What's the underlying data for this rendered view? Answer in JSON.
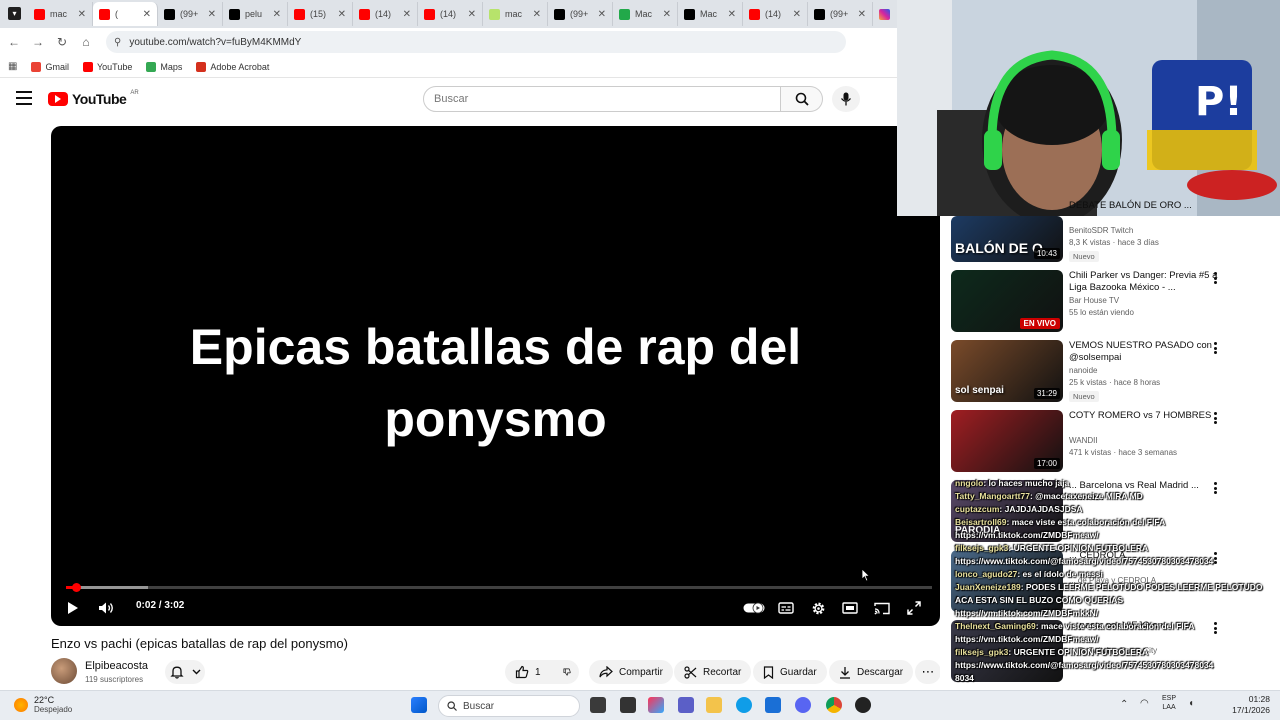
{
  "browser": {
    "tabs": [
      {
        "label": "mac",
        "color": "#ff0000"
      },
      {
        "label": "(",
        "color": "#ff0000"
      },
      {
        "label": "(99+",
        "color": "#000000"
      },
      {
        "label": "pelu",
        "color": "#000000"
      },
      {
        "label": "(15)",
        "color": "#ff0000"
      },
      {
        "label": "(14)",
        "color": "#ff0000"
      },
      {
        "label": "(14)",
        "color": "#ff0000"
      },
      {
        "label": "mac",
        "color": "#b7e36b"
      },
      {
        "label": "(99+",
        "color": "#000000"
      },
      {
        "label": "Mac",
        "color": "#22a94a"
      },
      {
        "label": "Mac",
        "color": "#000000"
      },
      {
        "label": "(14)",
        "color": "#ff0000"
      },
      {
        "label": "(99+",
        "color": "#000000"
      }
    ],
    "close_glyph": "✕",
    "url": "youtube.com/watch?v=fuByM4KMMdY",
    "bookmarks": [
      {
        "label": "Gmail",
        "color": "#ea4335"
      },
      {
        "label": "YouTube",
        "color": "#ff0000"
      },
      {
        "label": "Maps",
        "color": "#34a853"
      },
      {
        "label": "Adobe Acrobat",
        "color": "#d4301d"
      }
    ]
  },
  "youtube": {
    "logo_text": "YouTube",
    "logo_region": "AR",
    "search_placeholder": "Buscar"
  },
  "player": {
    "overlay_title_line1": "Epicas batallas de rap del",
    "overlay_title_line2": "ponysmo",
    "time": "0:02 / 3:02",
    "played_fraction": 0.011,
    "buffered_fraction": 0.095
  },
  "video": {
    "title": "Enzo vs pachi (epicas batallas de rap del ponysmo)",
    "channel_name": "Elpibeacosta",
    "subscribers": "119 suscriptores",
    "likes": "1",
    "share_label": "Compartir",
    "clip_label": "Recortar",
    "save_label": "Guardar",
    "download_label": "Descargar",
    "more_glyph": "⋯"
  },
  "recommendations": [
    {
      "title": "DEBATE BALÓN DE ORO ...",
      "channel": "BenitoSDR Twitch",
      "meta": "8,3 K vistas · hace 3 días",
      "badge": "Nuevo",
      "thumb_text": "BALÓN DE O",
      "duration": "10:43",
      "thumb_color": "#1d3b63"
    },
    {
      "title": "Chili Parker vs Danger: Previa #5 a Liga Bazooka México - ...",
      "channel": "Bar House TV",
      "meta": "55 lo están viendo",
      "badge": "",
      "thumb_text": "",
      "duration": "EN VIVO",
      "thumb_color": "#0d2a1c"
    },
    {
      "title": "VEMOS NUESTRO PASADO con @solsempai",
      "channel": "nanoide",
      "meta": "25 k vistas · hace 8 horas",
      "badge": "Nuevo",
      "thumb_text": "sol senpai",
      "duration": "31:29",
      "thumb_color": "#7a4b2a"
    },
    {
      "title": "COTY ROMERO vs 7 HOMBRES",
      "channel": "WANDII",
      "meta": "471 k vistas · hace 3 semanas",
      "badge": "",
      "thumb_text": "",
      "duration": "17:00",
      "thumb_color": "#a01e22"
    },
    {
      "title": "... Barcelona vs Real Madrid ... Mareo...",
      "channel": "",
      "meta": "",
      "badge": "",
      "thumb_text": "PARODIA",
      "duration": "",
      "thumb_color": "#5a4a6a"
    },
    {
      "title": "... CEDROLA",
      "channel": "... de Playa y CEDROLA",
      "meta": "",
      "badge": "",
      "thumb_text": "",
      "duration": "",
      "thumb_color": "#4a6a8a"
    },
    {
      "title": "... pasar por VIEJO en ...",
      "channel": "... Tv Twitch y Rama City",
      "meta": "",
      "badge": "",
      "thumb_text": "",
      "duration": "",
      "thumb_color": "#3a3a4a"
    }
  ],
  "chat": [
    {
      "user": "nngolo",
      "text": ": lo haces mucho jaja"
    },
    {
      "user": "Tatty_Mangoartt77",
      "text": ": @macetaxeneize MIRA MD"
    },
    {
      "user": "cuptazcum",
      "text": ": JAJDJAJDASJDSA"
    },
    {
      "user": "Beisartroll69",
      "text": ": mace viste esta colaboración del FIFA"
    },
    {
      "user": "",
      "text": "https://vm.tiktok.com/ZMDBFmeaw/"
    },
    {
      "user": "filksejs_gpk3",
      "text": ": URGENTE OPINION FUTBOLERA"
    },
    {
      "user": "",
      "text": "https://www.tiktok.com/@famosarg/video/7574530780303478034"
    },
    {
      "user": "lonco_agudo27",
      "text": ": es el ídolo de messi"
    },
    {
      "user": "JuanXeneize189",
      "text": ": PODES LEERME PELOTUDO  PODES LEERME PELOTUDO"
    },
    {
      "user": "",
      "text": "ACA ESTA SIN EL BUZO COMO QUERIAS"
    },
    {
      "user": "",
      "text": "https://vm.tiktok.com/ZMDBFmkkN/"
    },
    {
      "user": "Thelnext_Gaming69",
      "text": ": mace viste esta colaboración del FIFA"
    },
    {
      "user": "",
      "text": "https://vm.tiktok.com/ZMDBFmeaw/"
    },
    {
      "user": "filksejs_gpk3",
      "text": ": URGENTE OPINION FUTBOLERA"
    },
    {
      "user": "",
      "text": "https://www.tiktok.com/@famosarg/video/7574530780303478034"
    },
    {
      "user": "",
      "text": "8034"
    }
  ],
  "taskbar": {
    "temperature": "22°C",
    "weather": "Despejado",
    "search_label": "Buscar",
    "lang_line1": "ESP",
    "lang_line2": "LAA",
    "time": "01:28",
    "date": "17/1/2026"
  }
}
